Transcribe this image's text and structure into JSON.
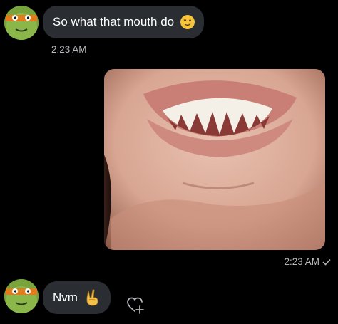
{
  "conversation": {
    "incoming_message": {
      "text": "So what that mouth do",
      "emoji": "wink-emoji",
      "time": "2:23 AM"
    },
    "outgoing_media": {
      "type": "photo",
      "description_icon": "image-icon",
      "time": "2:23 AM",
      "status_icon": "check-icon"
    },
    "incoming_reply": {
      "text": "Nvm",
      "emoji": "peace-hand-emoji"
    },
    "react_icon": "add-reaction-icon"
  },
  "colors": {
    "background": "#000000",
    "bubble": "#2a2d31",
    "timestamp": "#b7b9bd",
    "text": "#ffffff"
  }
}
